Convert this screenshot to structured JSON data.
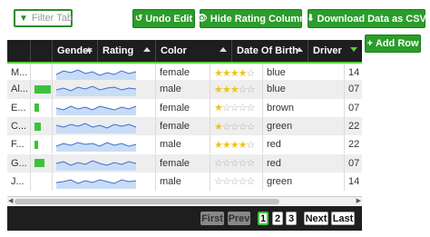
{
  "toolbar": {
    "filter_placeholder": "Filter Tab",
    "undo_label": "Undo Edit",
    "hide_rating_label": "Hide Rating Column",
    "download_label": "Download Data as CSV",
    "add_row_label": "Add Row"
  },
  "columns": [
    "Gender",
    "Rating",
    "Color",
    "Date Of Birth",
    "Driver"
  ],
  "rows": [
    {
      "name": "M...",
      "bar": 0,
      "gender": "female",
      "stars": 4,
      "color": "blue",
      "dob": "14"
    },
    {
      "name": "Al...",
      "bar": 18,
      "gender": "male",
      "stars": 3,
      "color": "blue",
      "dob": "07"
    },
    {
      "name": "E...",
      "bar": 5,
      "gender": "female",
      "stars": 1,
      "color": "brown",
      "dob": "07"
    },
    {
      "name": "C...",
      "bar": 7,
      "gender": "female",
      "stars": 1,
      "color": "green",
      "dob": "22"
    },
    {
      "name": "F...",
      "bar": 4,
      "gender": "male",
      "stars": 4,
      "color": "red",
      "dob": "22"
    },
    {
      "name": "G...",
      "bar": 11,
      "gender": "female",
      "stars": 0,
      "color": "red",
      "dob": "07"
    },
    {
      "name": "J...",
      "bar": 0,
      "gender": "male",
      "stars": 0,
      "color": "green",
      "dob": "14"
    }
  ],
  "pagination": {
    "first": "First",
    "prev": "Prev",
    "pages": [
      "1",
      "2",
      "3"
    ],
    "current": "1",
    "next": "Next",
    "last": "Last"
  },
  "colors": {
    "accent": "#2a9d2a",
    "header_bg": "#1e1e1e",
    "progress": "#3cc23c",
    "star": "#f0c419"
  }
}
